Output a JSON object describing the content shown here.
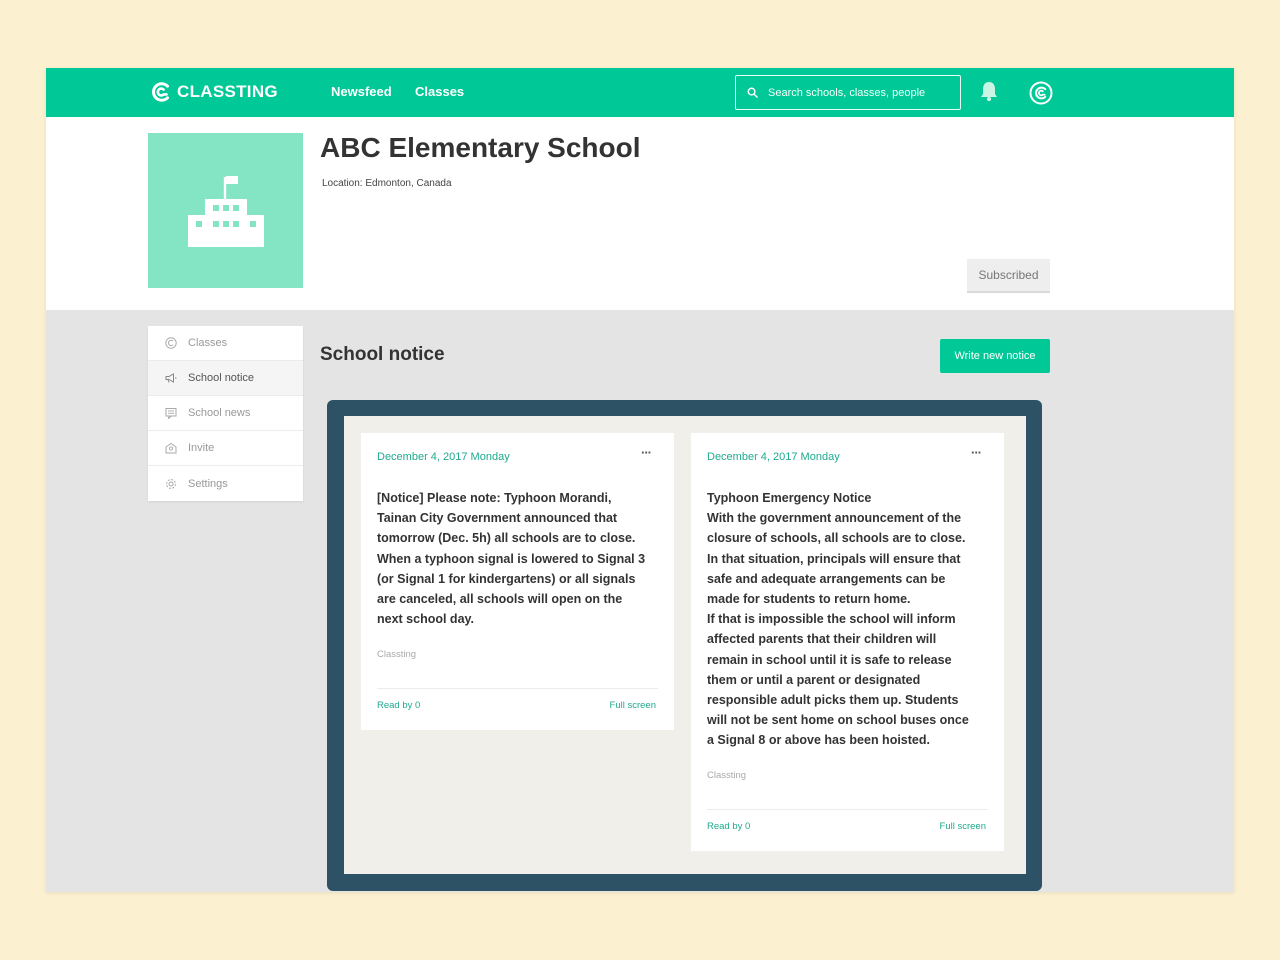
{
  "app": {
    "name": "CLASSTING"
  },
  "nav": {
    "newsfeed": "Newsfeed",
    "classes": "Classes"
  },
  "search": {
    "placeholder": "Search schools, classes, people"
  },
  "school": {
    "name": "ABC Elementary School",
    "location": "Location: Edmonton, Canada",
    "subscribe_label": "Subscribed"
  },
  "sidebar": {
    "items": [
      {
        "label": "Classes",
        "icon": "classting-icon"
      },
      {
        "label": "School notice",
        "icon": "megaphone-icon",
        "active": true
      },
      {
        "label": "School news",
        "icon": "news-icon"
      },
      {
        "label": "Invite",
        "icon": "invite-icon"
      },
      {
        "label": "Settings",
        "icon": "gear-icon"
      }
    ]
  },
  "content": {
    "title": "School notice",
    "write_label": "Write new notice"
  },
  "notices": [
    {
      "date": "December 4, 2017 Monday",
      "more": "···",
      "body": "[Notice] Please note: Typhoon Morandi,\nTainan City Government announced that\ntomorrow (Dec. 5h) all schools are to close.\nWhen a typhoon signal is lowered to Signal 3\n(or Signal 1 for kindergartens) or all signals\nare canceled, all schools will open on the\nnext school day.",
      "source": "Classting",
      "read": "Read by 0",
      "full": "Full screen"
    },
    {
      "date": "December 4, 2017 Monday",
      "more": "···",
      "body": "Typhoon Emergency Notice\nWith the government announcement of the\nclosure of schools, all schools are to close.\nIn that situation, principals will ensure that\nsafe and adequate arrangements can be\nmade for students to return home.\nIf that is impossible the school will inform\naffected parents that their children will\nremain in school until it is safe to release\nthem or until a parent or designated\nresponsible adult picks them up. Students\nwill not be sent home on school buses once\na Signal 8 or above has been hoisted.",
      "source": "Classting",
      "read": "Read by 0",
      "full": "Full screen"
    }
  ],
  "colors": {
    "brand": "#00c896",
    "frame": "#2e5265",
    "school_image": "#84e5c5",
    "link": "#1faa8f"
  }
}
